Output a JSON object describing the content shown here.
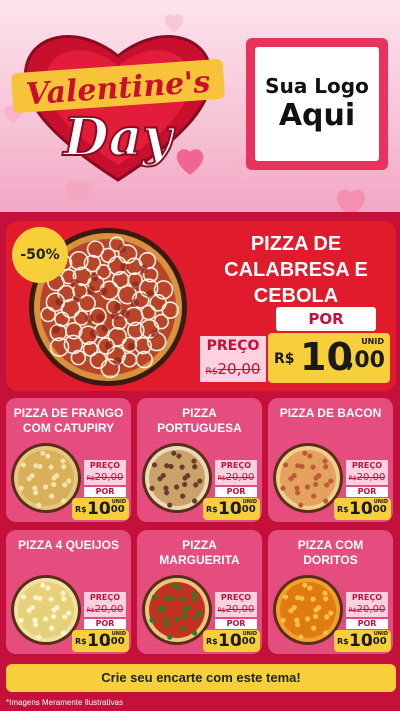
{
  "hero": {
    "valentine_text": "Valentine's",
    "day_text": "Day",
    "logo_line1": "Sua Logo",
    "logo_line2": "Aqui"
  },
  "featured": {
    "discount": "-50%",
    "title_lines": [
      "PIZZA DE",
      "CALABRESA E",
      "CEBOLA"
    ],
    "preco_label": "PREÇO",
    "old_price_currency": "R$",
    "old_price_value": "20,00",
    "por_label": "POR",
    "new_price_currency": "R$",
    "new_price_int": "10",
    "new_price_dec": ",00",
    "unid": "UNID"
  },
  "cards": [
    {
      "title": [
        "PIZZA DE FRANGO",
        "COM CATUPIRY"
      ],
      "preco": "PREÇO",
      "old": "20,00",
      "old_cur": "R$",
      "por": "POR",
      "cur": "R$",
      "int": "10",
      "dec": ",00",
      "unid": "UNID",
      "style": "frango"
    },
    {
      "title": [
        "PIZZA",
        "PORTUGUESA"
      ],
      "preco": "PREÇO",
      "old": "20,00",
      "old_cur": "R$",
      "por": "POR",
      "cur": "R$",
      "int": "10",
      "dec": ",00",
      "unid": "UNID",
      "style": "portuguesa"
    },
    {
      "title": [
        "PIZZA DE BACON"
      ],
      "preco": "PREÇO",
      "old": "20,00",
      "old_cur": "R$",
      "por": "POR",
      "cur": "R$",
      "int": "10",
      "dec": ",00",
      "unid": "UNID",
      "style": "bacon"
    },
    {
      "title": [
        "PIZZA 4 QUEIJOS"
      ],
      "preco": "PREÇO",
      "old": "20,00",
      "old_cur": "R$",
      "por": "POR",
      "cur": "R$",
      "int": "10",
      "dec": ",00",
      "unid": "UNID",
      "style": "queijos"
    },
    {
      "title": [
        "PIZZA",
        "MARGUERITA"
      ],
      "preco": "PREÇO",
      "old": "20,00",
      "old_cur": "R$",
      "por": "POR",
      "cur": "R$",
      "int": "10",
      "dec": ",00",
      "unid": "UNID",
      "style": "marguerita"
    },
    {
      "title": [
        "PIZZA COM",
        "DORITOS"
      ],
      "preco": "PREÇO",
      "old": "20,00",
      "old_cur": "R$",
      "por": "POR",
      "cur": "R$",
      "int": "10",
      "dec": ",00",
      "unid": "UNID",
      "style": "doritos"
    }
  ],
  "cta": "Crie seu encarte com este tema!",
  "footnote": "*Imagens Meramente Ilustrativas",
  "colors": {
    "red": "#e01b2c",
    "pink_card": "#e54d7e",
    "yellow": "#f6cf3b",
    "bg": "#c4103a"
  }
}
